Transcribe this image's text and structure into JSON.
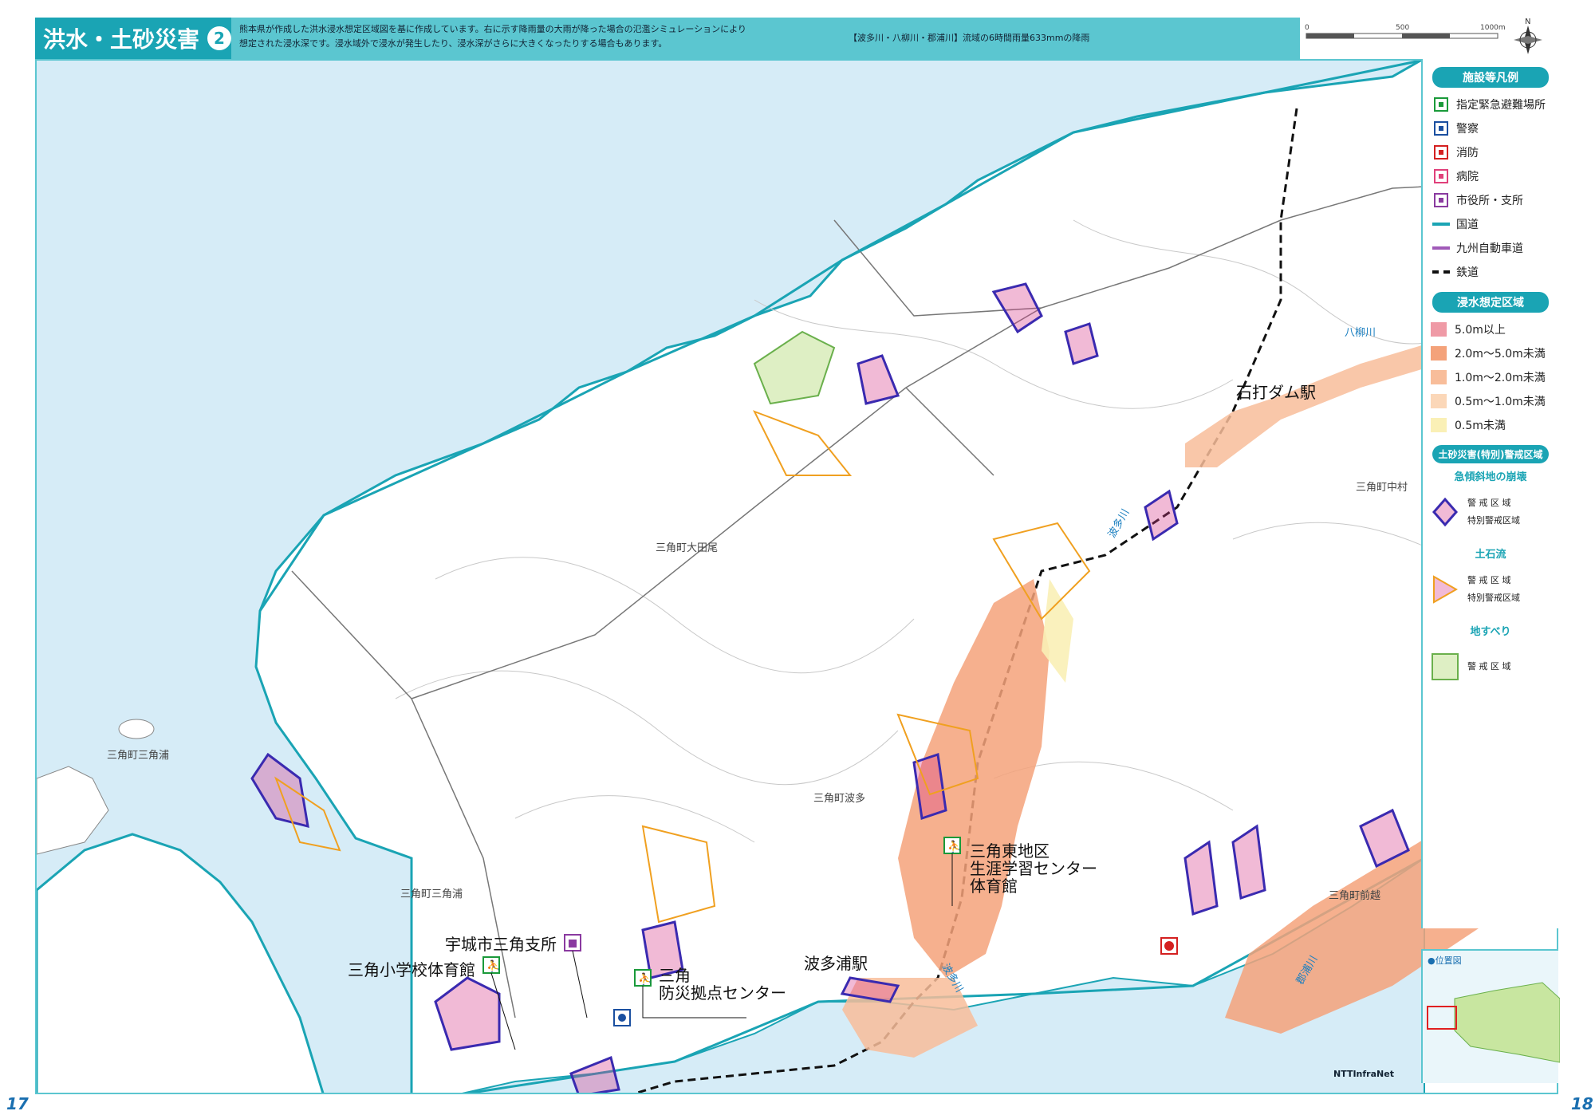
{
  "header": {
    "title": "洪水・土砂災害",
    "title_number": "2",
    "description_line1": "熊本県が作成した洪水浸水想定区域図を基に作成しています。右に示す降雨量の大雨が降った場合の氾濫シミュレーションにより",
    "description_line2": "想定された浸水深です。浸水域外で浸水が発生したり、浸水深がさらに大きくなったりする場合もあります。",
    "rain_note": "【波多川・八柳川・郡浦川】流域の6時間雨量633mmの降雨"
  },
  "scale": {
    "ticks": [
      "0",
      "500",
      "1000m"
    ],
    "north": "N"
  },
  "map": {
    "big_labels": {
      "ishiuchi_dam_station": "石打ダム駅",
      "higashi_center": [
        "三角東地区",
        "生涯学習センター",
        "体育館"
      ],
      "uki_branch": "宇城市三角支所",
      "misumi_school": "三角小学校体育館",
      "bousai_center": [
        "三角",
        "防災拠点センター"
      ],
      "hatoura_station": "波多浦駅"
    },
    "place_labels": {
      "ota": "三角町大田尾",
      "hatoura_town": "三角町波多",
      "misumiura_island": "三角町三角浦",
      "misumiura": "三角町三角浦",
      "nakamura": "三角町中村",
      "maegoe": "三角町前越"
    },
    "river_labels": {
      "yayanagi": "八柳川",
      "hata_upper": "波多川",
      "hata_lower": "波多川",
      "koura": "郡浦川"
    }
  },
  "legend": {
    "facilities_title": "施設等凡例",
    "facilities": [
      {
        "label": "指定緊急避難場所",
        "icon": "evacuation-icon",
        "color": "#1a9a3a"
      },
      {
        "label": "警察",
        "icon": "police-icon",
        "color": "#1a4fa0"
      },
      {
        "label": "消防",
        "icon": "fire-dept-icon",
        "color": "#d42020"
      },
      {
        "label": "病院",
        "icon": "hospital-icon",
        "color": "#e0407a"
      },
      {
        "label": "市役所・支所",
        "icon": "city-office-icon",
        "color": "#8a3aa0"
      },
      {
        "label": "国道",
        "icon": "national-road-line",
        "color": "#1aa4b4"
      },
      {
        "label": "九州自動車道",
        "icon": "expressway-line",
        "color": "#a05ab8"
      },
      {
        "label": "鉄道",
        "icon": "railway-line",
        "color": "#111111"
      }
    ],
    "flood_title": "浸水想定区域",
    "flood": [
      {
        "label": "5.0m以上",
        "color": "#ef9aa6"
      },
      {
        "label": "2.0m〜5.0m未満",
        "color": "#f4a27a"
      },
      {
        "label": "1.0m〜2.0m未満",
        "color": "#f8bd9a"
      },
      {
        "label": "0.5m〜1.0m未満",
        "color": "#fbd7b8"
      },
      {
        "label": "0.5m未満",
        "color": "#faf0b6"
      }
    ],
    "sediment_title": "土砂災害(特別)警戒区域",
    "slope_title": "急傾斜地の崩壊",
    "debris_title": "土石流",
    "landslide_title": "地すべり",
    "warning_zone": "警 戒 区 域",
    "special_zone": "特別警戒区域"
  },
  "location_map": {
    "title": "●位置図"
  },
  "pages": {
    "left": "17",
    "right": "18"
  },
  "publisher": "NTTInfraNet"
}
